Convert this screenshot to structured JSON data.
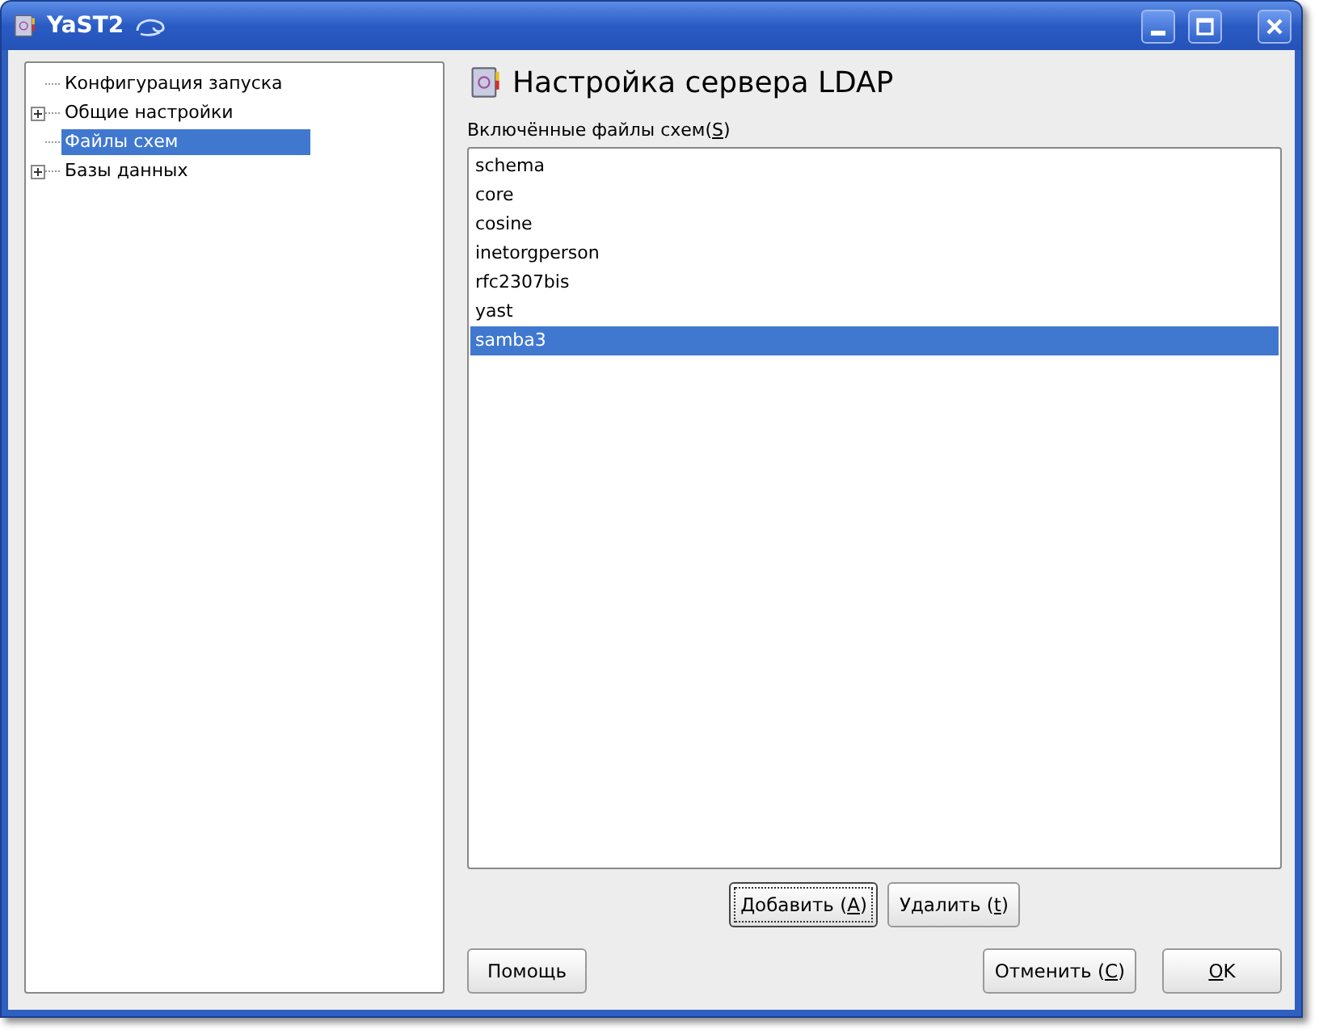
{
  "window": {
    "title": "YaST2"
  },
  "tree": {
    "items": [
      {
        "label": "Конфигурация запуска",
        "kind": "leaf",
        "selected": false
      },
      {
        "label": "Общие настройки",
        "kind": "branch",
        "expanded": false,
        "selected": false
      },
      {
        "label": "Файлы схем",
        "kind": "leaf",
        "selected": true
      },
      {
        "label": "Базы данных",
        "kind": "branch",
        "expanded": false,
        "selected": false
      }
    ]
  },
  "heading": "Настройка сервера LDAP",
  "list": {
    "label": {
      "before": "Включённые файлы схем(",
      "key": "S",
      "after": ")"
    },
    "items": [
      {
        "label": "schema",
        "selected": false
      },
      {
        "label": "core",
        "selected": false
      },
      {
        "label": "cosine",
        "selected": false
      },
      {
        "label": "inetorgperson",
        "selected": false
      },
      {
        "label": "rfc2307bis",
        "selected": false
      },
      {
        "label": "yast",
        "selected": false
      },
      {
        "label": "samba3",
        "selected": true
      }
    ]
  },
  "list_buttons": [
    {
      "before": "Добавить (",
      "key": "A",
      "after": ")",
      "focused": true
    },
    {
      "before": "Удалить (",
      "key": "t",
      "after": ")",
      "focused": false
    }
  ],
  "footer_buttons": [
    {
      "before": "Помощь"
    },
    {
      "before": "Отменить (",
      "key": "C",
      "after": ")"
    },
    {
      "key": "O",
      "after": "K"
    }
  ]
}
